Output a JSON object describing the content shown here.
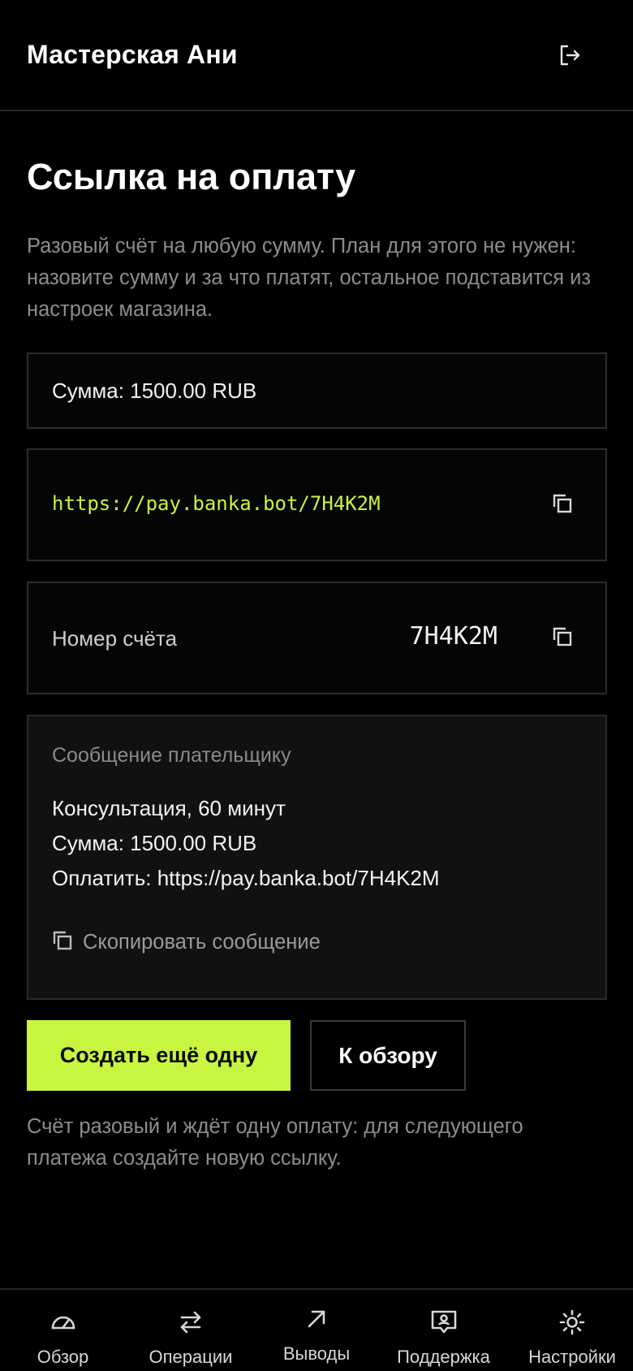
{
  "header": {
    "app_title": "Мастерская Ани",
    "logout_icon": "logout-icon"
  },
  "main": {
    "title": "Ссылка на оплату",
    "description": "Разовый счёт на любую сумму. План для этого не нужен: назовите сумму и за что платят, остальное подставится из настроек магазина.",
    "amount_text": "Сумма: 1500.00 RUB",
    "payment_link": "https://pay.banka.bot/7H4K2M",
    "invoice_label": "Номер счёта",
    "invoice_number": "7H4K2M",
    "message": {
      "heading": "Сообщение плательщику",
      "lines": [
        "Консультация, 60 минут",
        "Сумма: 1500.00 RUB",
        "Оплатить: https://pay.banka.bot/7H4K2M"
      ],
      "copy_label": "Скопировать сообщение"
    },
    "primary_button": "Создать ещё одну",
    "secondary_button": "К обзору",
    "footnote": "Счёт разовый и ждёт одну оплату: для следующего платежа создайте новую ссылку."
  },
  "bottom_nav": {
    "items": [
      {
        "label": "Обзор",
        "icon": "gauge-icon"
      },
      {
        "label": "Операции",
        "icon": "transfer-arrows-icon"
      },
      {
        "label": "Выводы",
        "icon": "arrow-up-right-icon"
      },
      {
        "label": "Поддержка",
        "icon": "support-chat-icon"
      },
      {
        "label": "Настройки",
        "icon": "settings-sun-icon"
      }
    ]
  },
  "colors": {
    "background": "#000000",
    "accent": "#c8f53f",
    "muted_text": "#8c8c8c",
    "border": "#2c2c2c"
  }
}
